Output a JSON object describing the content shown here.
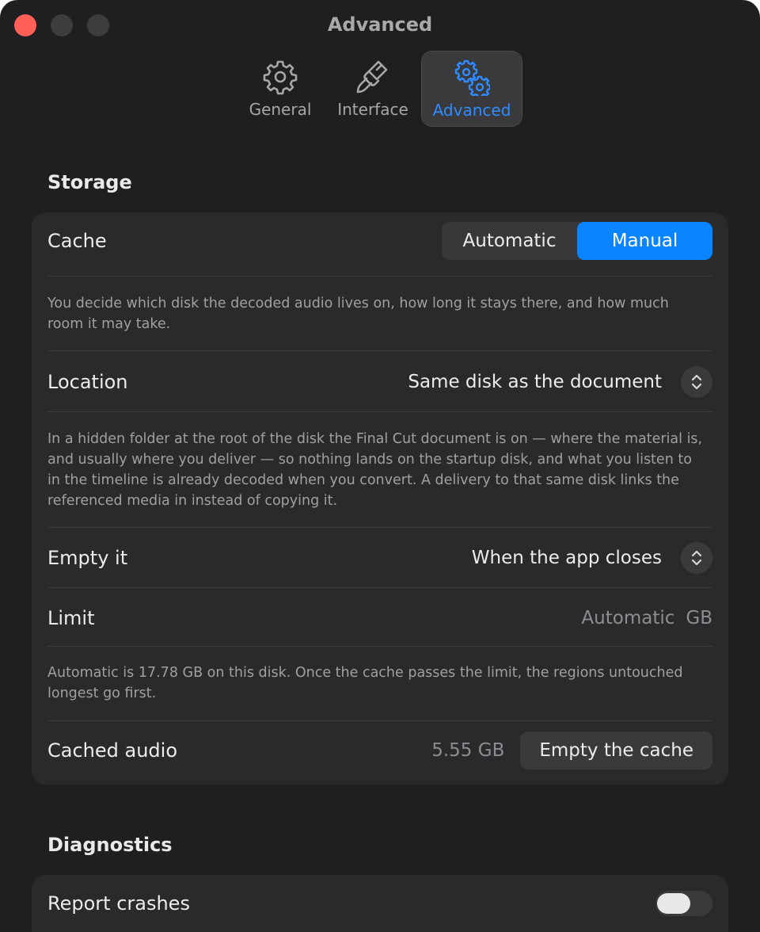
{
  "window": {
    "title": "Advanced"
  },
  "tabs": [
    {
      "label": "General",
      "icon": "gear-icon"
    },
    {
      "label": "Interface",
      "icon": "paintbrush-icon"
    },
    {
      "label": "Advanced",
      "icon": "gears-icon",
      "selected": true
    }
  ],
  "storage": {
    "title": "Storage",
    "cache": {
      "label": "Cache",
      "options": [
        "Automatic",
        "Manual"
      ],
      "selected": "Manual",
      "description": "You decide which disk the decoded audio lives on, how long it stays there, and how much room it may take."
    },
    "location": {
      "label": "Location",
      "value": "Same disk as the document",
      "description": "In a hidden folder at the root of the disk the Final Cut document is on — where the material is, and usually where you deliver — so nothing lands on the startup disk, and what you listen to in the timeline is already decoded when you convert. A delivery to that same disk links the referenced media in instead of copying it."
    },
    "empty_it": {
      "label": "Empty it",
      "value": "When the app closes"
    },
    "limit": {
      "label": "Limit",
      "value": "Automatic",
      "unit": "GB",
      "description": "Automatic is 17.78 GB on this disk. Once the cache passes the limit, the regions untouched longest go first."
    },
    "cached_audio": {
      "label": "Cached audio",
      "size": "5.55 GB",
      "button": "Empty the cache"
    }
  },
  "diagnostics": {
    "title": "Diagnostics",
    "report_crashes": {
      "label": "Report crashes",
      "enabled": false
    }
  },
  "colors": {
    "accent": "#0a84ff",
    "close": "#ff5f57",
    "background": "#1f1f21",
    "card": "#2a2a2d"
  }
}
